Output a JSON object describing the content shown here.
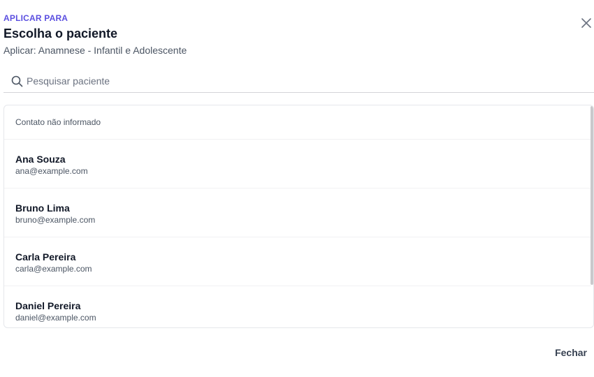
{
  "header": {
    "eyebrow": "APLICAR PARA",
    "title": "Escolha o paciente",
    "subtitle": "Aplicar: Anamnese - Infantil e Adolescente",
    "close_icon": "close-icon"
  },
  "search": {
    "icon": "search-icon",
    "placeholder": "Pesquisar paciente",
    "value": ""
  },
  "list": {
    "group_label": "Contato não informado",
    "patients": [
      {
        "name": "Ana Souza",
        "email": "ana@example.com"
      },
      {
        "name": "Bruno Lima",
        "email": "bruno@example.com"
      },
      {
        "name": "Carla Pereira",
        "email": "carla@example.com"
      },
      {
        "name": "Daniel Pereira",
        "email": "daniel@example.com"
      }
    ]
  },
  "footer": {
    "close_label": "Fechar"
  },
  "colors": {
    "accent": "#5b4fe0",
    "text": "#111827",
    "muted": "#4b5563",
    "border": "#e5e7eb"
  }
}
